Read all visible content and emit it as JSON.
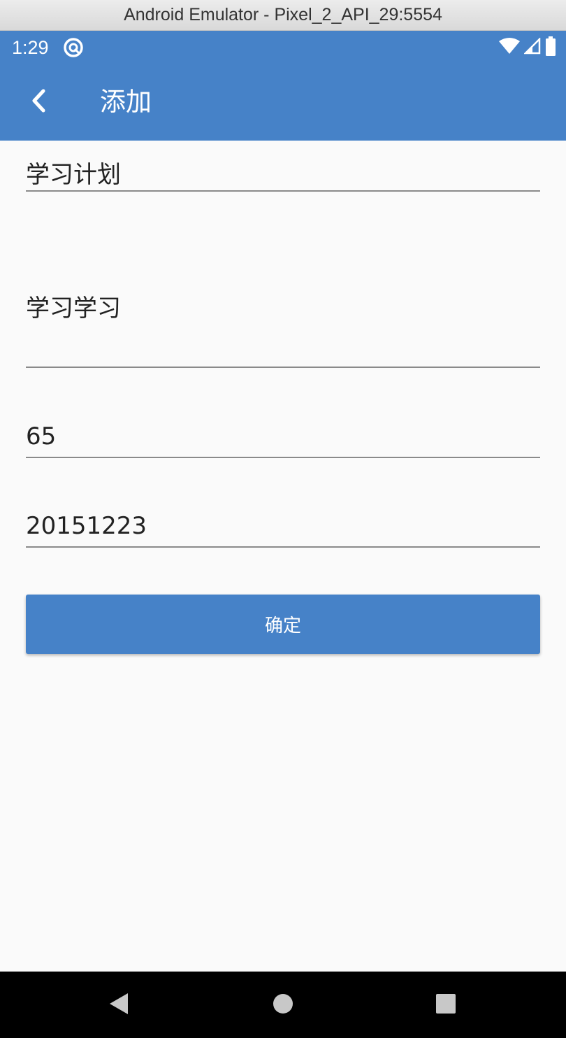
{
  "window": {
    "title": "Android Emulator - Pixel_2_API_29:5554"
  },
  "status_bar": {
    "time": "1:29",
    "icons": [
      "app-notification-icon",
      "wifi-icon",
      "signal-icon",
      "battery-icon"
    ]
  },
  "app_bar": {
    "back_icon": "chevron-left-icon",
    "title": "添加"
  },
  "form": {
    "fields": [
      {
        "name": "title",
        "value": "学习计划"
      },
      {
        "name": "content",
        "value": "学习学习"
      },
      {
        "name": "number",
        "value": "65"
      },
      {
        "name": "date",
        "value": "20151223"
      }
    ],
    "confirm_label": "确定"
  },
  "nav_bar": {
    "icons": [
      "back-triangle-icon",
      "home-circle-icon",
      "recents-square-icon"
    ]
  },
  "colors": {
    "primary": "#4682c8",
    "background": "#fafafa",
    "nav_bar": "#000000",
    "underline": "#8a8a8a"
  }
}
